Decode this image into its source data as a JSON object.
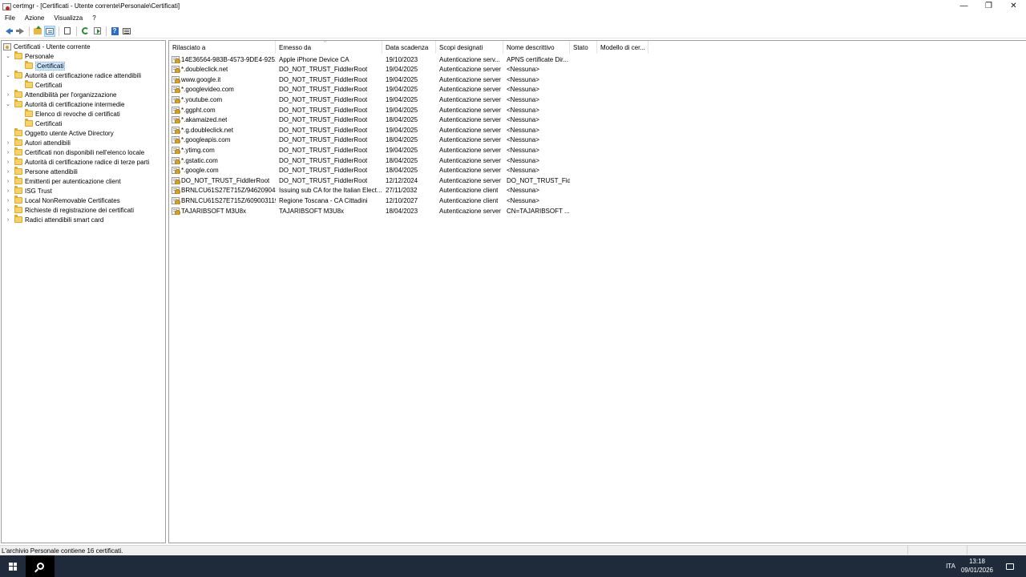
{
  "window": {
    "title": "certmgr - [Certificati - Utente corrente\\Personale\\Certificati]",
    "minimize_glyph": "—",
    "maximize_glyph": "❐",
    "close_glyph": "✕"
  },
  "menu": [
    "File",
    "Azione",
    "Visualizza",
    "?"
  ],
  "toolbar": {
    "icons": [
      "back-arrow-icon",
      "forward-arrow-icon",
      "folder-up-icon",
      "show-hide-tree-icon",
      "copy-icon",
      "refresh-icon",
      "export-list-icon",
      "help-icon",
      "properties-icon"
    ],
    "help_glyph": "?"
  },
  "tree": {
    "root": "Certificati - Utente corrente",
    "items": [
      {
        "label": "Personale",
        "expander": "⌄"
      },
      {
        "label": "Certificati",
        "expander": ""
      },
      {
        "label": "Autorità di certificazione radice attendibili",
        "expander": "⌄"
      },
      {
        "label": "Certificati",
        "expander": ""
      },
      {
        "label": "Attendibilità per l'organizzazione",
        "expander": "›"
      },
      {
        "label": "Autorità di certificazione intermedie",
        "expander": "⌄"
      },
      {
        "label": "Elenco di revoche di certificati",
        "expander": ""
      },
      {
        "label": "Certificati",
        "expander": ""
      },
      {
        "label": "Oggetto utente Active Directory",
        "expander": ""
      },
      {
        "label": "Autori attendibili",
        "expander": "›"
      },
      {
        "label": "Certificati non disponibili nell'elenco locale",
        "expander": "›"
      },
      {
        "label": "Autorità di certificazione radice di terze parti",
        "expander": "›"
      },
      {
        "label": "Persone attendibili",
        "expander": "›"
      },
      {
        "label": "Emittenti per autenticazione client",
        "expander": "›"
      },
      {
        "label": "ISG Trust",
        "expander": "›"
      },
      {
        "label": "Local NonRemovable Certificates",
        "expander": "›"
      },
      {
        "label": "Richieste di registrazione dei certificati",
        "expander": "›"
      },
      {
        "label": "Radici attendibili smart card",
        "expander": "›"
      }
    ]
  },
  "list": {
    "columns": [
      "Rilasciato a",
      "Emesso da",
      "Data scadenza",
      "Scopi designati",
      "Nome descrittivo",
      "Stato",
      "Modello di cer..."
    ],
    "sort_glyph": "^",
    "rows": [
      [
        "14E36564-983B-4573-9DE4-9251...",
        "Apple iPhone Device CA",
        "19/10/2023",
        "Autenticazione serv...",
        "APNS certificate Dir...",
        "",
        ""
      ],
      [
        "*.doubleclick.net",
        "DO_NOT_TRUST_FiddlerRoot",
        "19/04/2025",
        "Autenticazione server",
        "<Nessuna>",
        "",
        ""
      ],
      [
        "www.google.it",
        "DO_NOT_TRUST_FiddlerRoot",
        "19/04/2025",
        "Autenticazione server",
        "<Nessuna>",
        "",
        ""
      ],
      [
        "*.googlevideo.com",
        "DO_NOT_TRUST_FiddlerRoot",
        "19/04/2025",
        "Autenticazione server",
        "<Nessuna>",
        "",
        ""
      ],
      [
        "*.youtube.com",
        "DO_NOT_TRUST_FiddlerRoot",
        "19/04/2025",
        "Autenticazione server",
        "<Nessuna>",
        "",
        ""
      ],
      [
        "*.ggpht.com",
        "DO_NOT_TRUST_FiddlerRoot",
        "19/04/2025",
        "Autenticazione server",
        "<Nessuna>",
        "",
        ""
      ],
      [
        "*.akamaized.net",
        "DO_NOT_TRUST_FiddlerRoot",
        "18/04/2025",
        "Autenticazione server",
        "<Nessuna>",
        "",
        ""
      ],
      [
        "*.g.doubleclick.net",
        "DO_NOT_TRUST_FiddlerRoot",
        "19/04/2025",
        "Autenticazione server",
        "<Nessuna>",
        "",
        ""
      ],
      [
        "*.googleapis.com",
        "DO_NOT_TRUST_FiddlerRoot",
        "18/04/2025",
        "Autenticazione server",
        "<Nessuna>",
        "",
        ""
      ],
      [
        "*.ytimg.com",
        "DO_NOT_TRUST_FiddlerRoot",
        "19/04/2025",
        "Autenticazione server",
        "<Nessuna>",
        "",
        ""
      ],
      [
        "*.gstatic.com",
        "DO_NOT_TRUST_FiddlerRoot",
        "18/04/2025",
        "Autenticazione server",
        "<Nessuna>",
        "",
        ""
      ],
      [
        "*.google.com",
        "DO_NOT_TRUST_FiddlerRoot",
        "18/04/2025",
        "Autenticazione server",
        "<Nessuna>",
        "",
        ""
      ],
      [
        "DO_NOT_TRUST_FiddlerRoot",
        "DO_NOT_TRUST_FiddlerRoot",
        "12/12/2024",
        "Autenticazione server",
        "DO_NOT_TRUST_Fid...",
        "",
        ""
      ],
      [
        "BRNLCU61S27E715Z/946209043...",
        "Issuing sub CA for the Italian Elect...",
        "27/11/2032",
        "Autenticazione client",
        "<Nessuna>",
        "",
        ""
      ],
      [
        "BRNLCU61S27E715Z/609003119...",
        "Regione Toscana - CA Cittadini",
        "12/10/2027",
        "Autenticazione client",
        "<Nessuna>",
        "",
        ""
      ],
      [
        "TAJARIBSOFT M3U8x",
        "TAJARIBSOFT M3U8x",
        "18/04/2023",
        "Autenticazione server",
        "CN=TAJARIBSOFT ...",
        "",
        ""
      ]
    ]
  },
  "status": {
    "text": "L'archivio Personale contiene 16 certificati."
  },
  "taskbar": {
    "language": "ITA",
    "time": "13:18",
    "date": "09/01/2026"
  }
}
